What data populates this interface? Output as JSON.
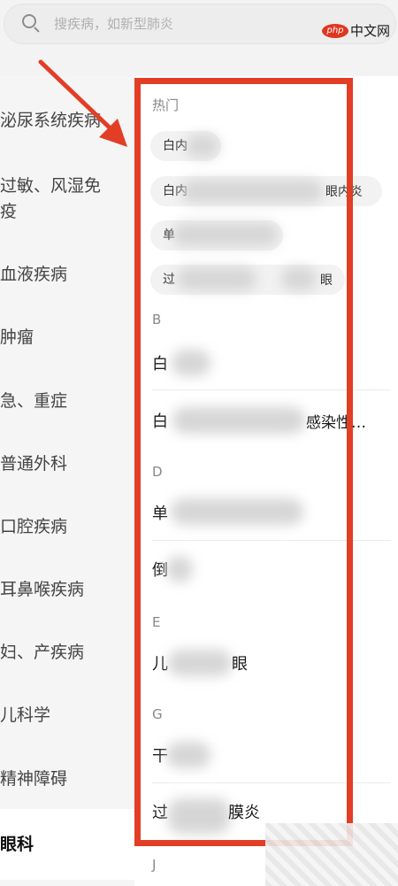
{
  "search": {
    "placeholder": "搜疾病，如新型肺炎"
  },
  "watermark": {
    "logo_small": "php",
    "logo_text": "中文网"
  },
  "categories": [
    "泌尿系统疾病",
    "过敏、风湿免",
    "疫",
    "血液疾病",
    "肿瘤",
    "急、重症",
    "普通外科",
    "口腔疾病",
    "耳鼻喉疾病",
    "妇、产疾病",
    "儿科学",
    "精神障碍",
    "眼科"
  ],
  "sections": {
    "hot": "热门",
    "b": "B",
    "d": "D",
    "e": "E",
    "g": "G",
    "j": "J"
  },
  "hot_tags": [
    {
      "start": "白内",
      "end": ""
    },
    {
      "start": "白内",
      "end": "眼内炎"
    },
    {
      "start": "单",
      "end": ""
    },
    {
      "start": "过",
      "end": "眼"
    }
  ],
  "diseases": {
    "b1": {
      "start": "白",
      "end": ""
    },
    "b2": {
      "start": "白",
      "end": "感染性…"
    },
    "d1": {
      "start": "单",
      "end": ""
    },
    "d2": {
      "start": "倒",
      "end": ""
    },
    "e1": {
      "start": "儿",
      "end": "眼"
    },
    "g1": {
      "start": "干",
      "end": ""
    },
    "g2": {
      "start": "过",
      "end": "膜炎"
    }
  },
  "colors": {
    "annotation": "#e23e26",
    "accent_logo": "#e0351f"
  }
}
